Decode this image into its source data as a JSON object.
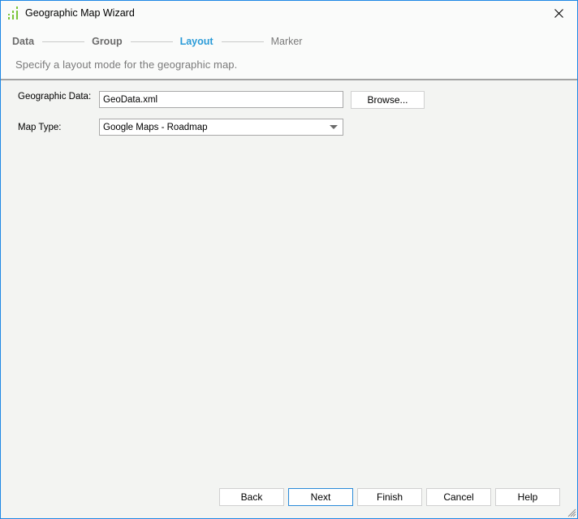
{
  "window": {
    "title": "Geographic Map Wizard",
    "app_icon": "bar-chart-icon",
    "close_icon": "close-icon",
    "accent_color": "#1e88e5"
  },
  "wizard": {
    "steps": [
      {
        "label": "Data",
        "state": "done"
      },
      {
        "label": "Group",
        "state": "done"
      },
      {
        "label": "Layout",
        "state": "active"
      },
      {
        "label": "Marker",
        "state": "future"
      }
    ],
    "subtitle": "Specify a layout mode for the geographic map.",
    "active_color": "#2a9bd8"
  },
  "form": {
    "geo_data_label": "Geographic Data:",
    "geo_data_value": "GeoData.xml",
    "browse_label": "Browse...",
    "map_type_label": "Map Type:",
    "map_type_value": "Google Maps - Roadmap"
  },
  "buttons": {
    "back": "Back",
    "next": "Next",
    "finish": "Finish",
    "cancel": "Cancel",
    "help": "Help"
  }
}
